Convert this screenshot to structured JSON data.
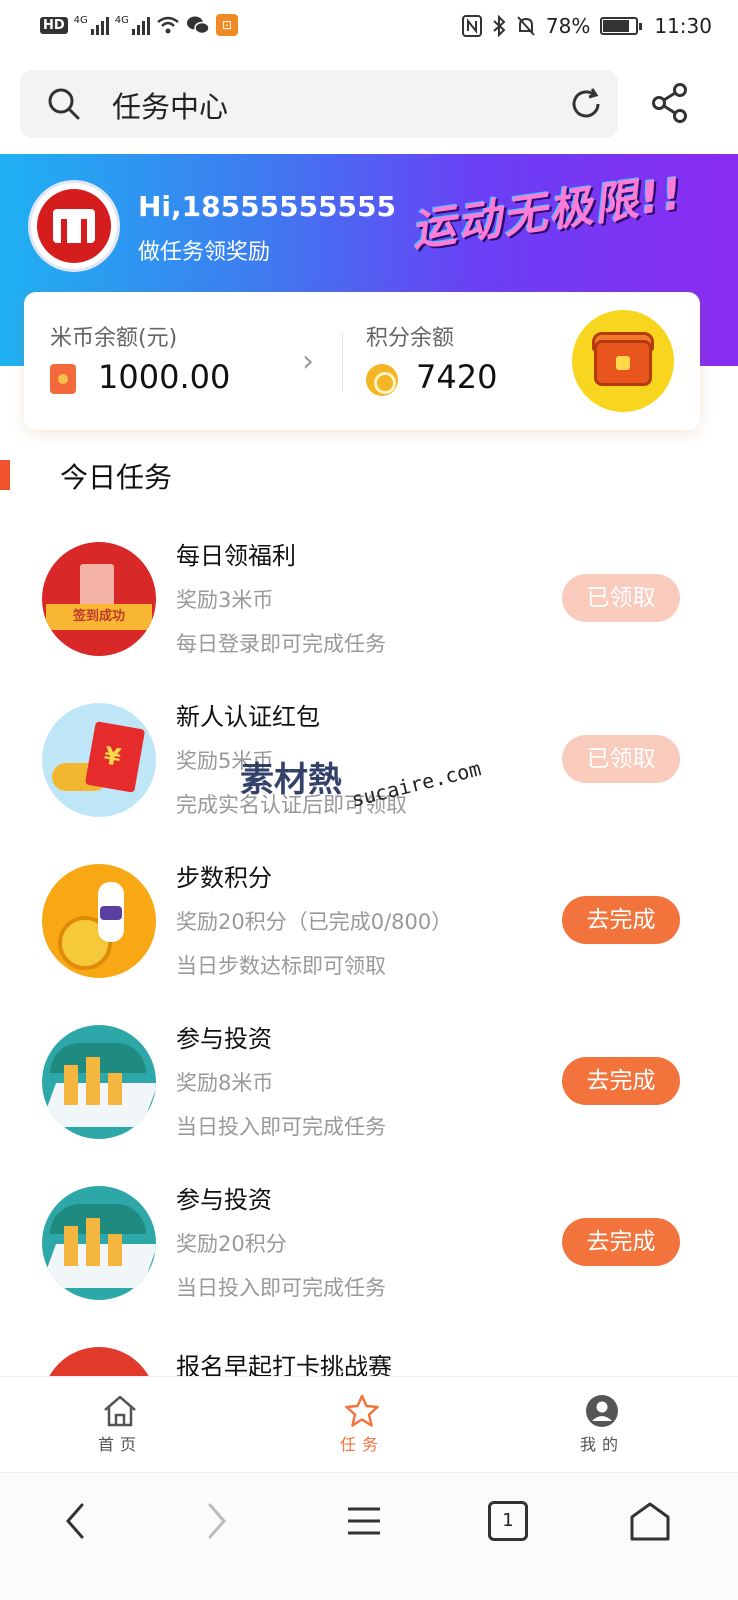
{
  "status_bar": {
    "hd_badge": "HD",
    "network1": "4G",
    "network2": "4G",
    "battery_pct": "78%",
    "time": "11:30"
  },
  "search": {
    "title": "任务中心"
  },
  "banner": {
    "greeting": "Hi,18555555555",
    "subtitle": "做任务领奖励",
    "slogan": "运动无极限!!"
  },
  "balance": {
    "coin_label": "米币余额(元)",
    "coin_value": "1000.00",
    "points_label": "积分余额",
    "points_value": "7420"
  },
  "section": {
    "title": "今日任务"
  },
  "tasks": [
    {
      "title": "每日领福利",
      "reward": "奖励3米币",
      "desc": "每日登录即可完成任务",
      "button": "已领取",
      "state": "done",
      "thumb_text": "签到成功"
    },
    {
      "title": "新人认证红包",
      "reward": "奖励5米币",
      "desc": "完成实名认证后即可领取",
      "button": "已领取",
      "state": "done"
    },
    {
      "title": "步数积分",
      "reward": "奖励20积分（已完成0/800）",
      "desc": "当日步数达标即可领取",
      "button": "去完成",
      "state": "todo"
    },
    {
      "title": "参与投资",
      "reward": "奖励8米币",
      "desc": "当日投入即可完成任务",
      "button": "去完成",
      "state": "todo"
    },
    {
      "title": "参与投资",
      "reward": "奖励20积分",
      "desc": "当日投入即可完成任务",
      "button": "去完成",
      "state": "todo"
    },
    {
      "title": "报名早起打卡挑战赛"
    }
  ],
  "tabbar": {
    "home": "首页",
    "tasks": "任务",
    "mine": "我的",
    "active_color": "#f2733c",
    "inactive_color": "#555555"
  },
  "browser": {
    "tab_count": "1"
  },
  "watermark": {
    "text": "素材熱",
    "url": "sucaire.com"
  },
  "colors": {
    "accent": "#f2733c",
    "done_button": "#f8cbbd",
    "banner_start": "#1fb1f2",
    "banner_end": "#8a2bf0"
  }
}
